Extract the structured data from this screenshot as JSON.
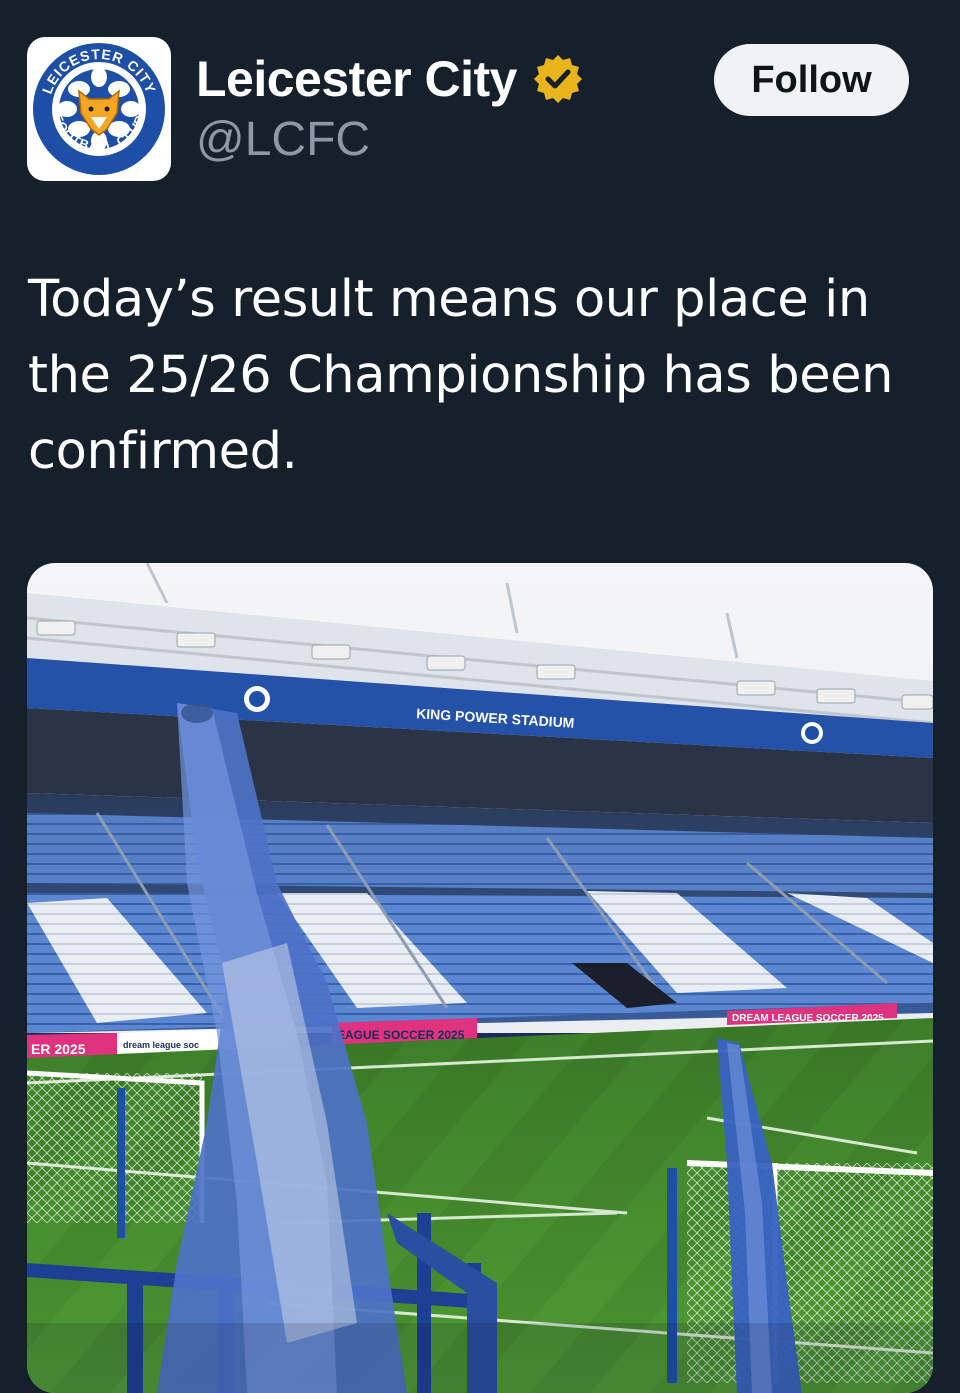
{
  "account": {
    "display_name": "Leicester City",
    "handle": "@LCFC",
    "verified": true,
    "verified_badge_color": "#e8b51c",
    "avatar_icon": "club-crest",
    "crest_text_top": "LEICESTER CITY",
    "crest_text_bottom": "FOOTBALL CLUB"
  },
  "follow_button": {
    "label": "Follow"
  },
  "tweet": {
    "text": "Today’s result means our place in the 25/26 Championship has been confirmed."
  },
  "media": {
    "stadium_sign": "KING POWER STADIUM",
    "ad_board_left": "ER 2025",
    "ad_board_left_small": "dream league soc",
    "ad_board_center": "EAGUE SOCCER 2025",
    "ad_board_right": "DREAM LEAGUE SOCCER 2025"
  },
  "colors": {
    "background": "#15202b",
    "secondary_text": "#8b98a5",
    "button_bg": "#eff3f4",
    "club_blue": "#1d4fa6",
    "pitch_green": "#3f8a2a"
  }
}
